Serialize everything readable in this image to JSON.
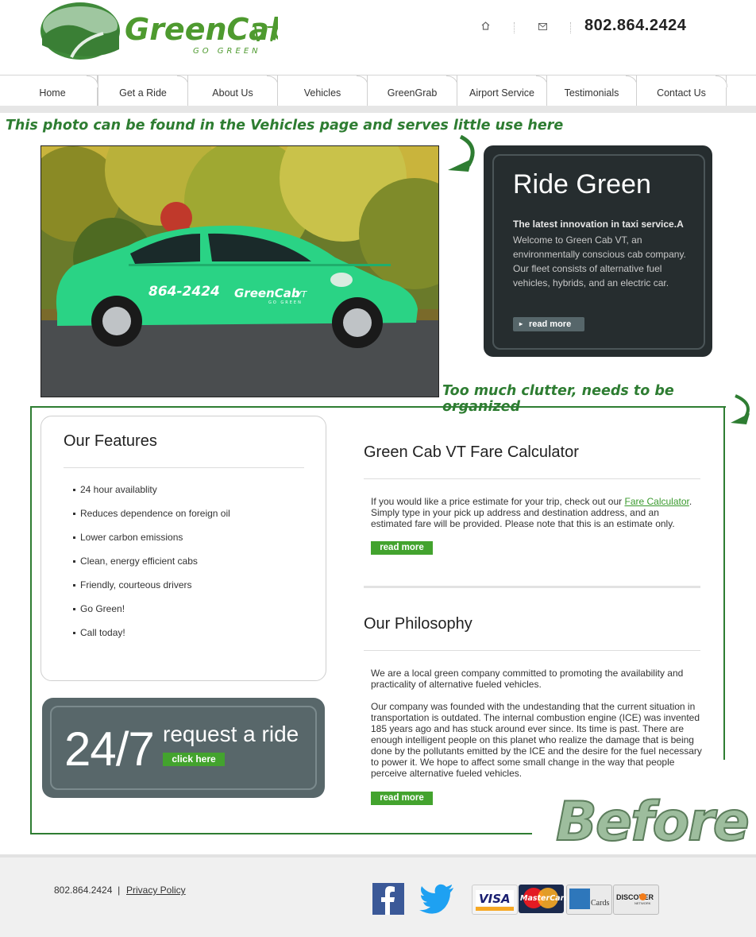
{
  "header": {
    "logo_text": "GreenCab",
    "logo_suffix": "VT",
    "logo_tagline": "GO GREEN",
    "home_icon": "home-icon",
    "mail_icon": "mail-icon",
    "phone": "802.864.2424"
  },
  "nav": {
    "items": [
      {
        "label": "Home"
      },
      {
        "label": "Get a Ride"
      },
      {
        "label": "About Us"
      },
      {
        "label": "Vehicles"
      },
      {
        "label": "GreenGrab"
      },
      {
        "label": "Airport Service"
      },
      {
        "label": "Testimonials"
      },
      {
        "label": "Contact Us"
      }
    ]
  },
  "annotations": {
    "photo_note": "This photo can be found in the Vehicles page and serves little use here",
    "clutter_note": "Too much clutter, needs to be organized",
    "stamp": "Before"
  },
  "photo": {
    "cab_number": "864-2424",
    "cab_logo": "GreenCab",
    "cab_logo_suffix": "VT",
    "cab_tagline": "GO GREEN"
  },
  "ride_green": {
    "title": "Ride Green",
    "lead": "The latest innovation in taxi service.A",
    "body": "Welcome to Green Cab VT, an environmentally conscious cab company. Our fleet consists of alternative fuel vehicles, hybrids, and an electric car.",
    "button": "read more"
  },
  "features": {
    "title": "Our Features",
    "items": [
      "24 hour availablity",
      "Reduces dependence on foreign oil",
      "Lower carbon emissions",
      "Clean, energy efficient cabs",
      "Friendly, courteous drivers",
      "Go Green!",
      "Call today!"
    ]
  },
  "request": {
    "number": "24/7",
    "text": "request a ride",
    "button": "click here"
  },
  "fare": {
    "title": "Green Cab VT Fare Calculator",
    "text_before": "If you would like a price estimate for your trip, check out our ",
    "link": "Fare Calculator",
    "text_after": ". Simply type in your pick up address and destination address, and an estimated fare will be provided. Please note that this is an estimate only.",
    "button": "read more"
  },
  "philosophy": {
    "title": "Our Philosophy",
    "para1": "We are a local green company committed to promoting the availability and practicality of alternative fueled vehicles.",
    "para2": "Our company was founded with the undestanding that the current situation in transportation is outdated. The internal combustion engine (ICE) was invented 185 years ago and has stuck around ever since. Its time is past. There are enough intelligent people on this planet who realize the damage that is being done by the pollutants emitted by the ICE and the desire for the fuel necessary to power it. We hope to affect some small change in the way that people perceive alternative fueled vehicles.",
    "button": "read more"
  },
  "footer": {
    "phone": "802.864.2424",
    "separator": "|",
    "privacy": "Privacy Policy",
    "social": [
      "facebook-icon",
      "twitter-icon"
    ],
    "cards": {
      "visa": "VISA",
      "mastercard": "MasterCard",
      "amex": "Cards",
      "discover": "DISCOVER",
      "discover_sub": "NETWORK"
    }
  }
}
